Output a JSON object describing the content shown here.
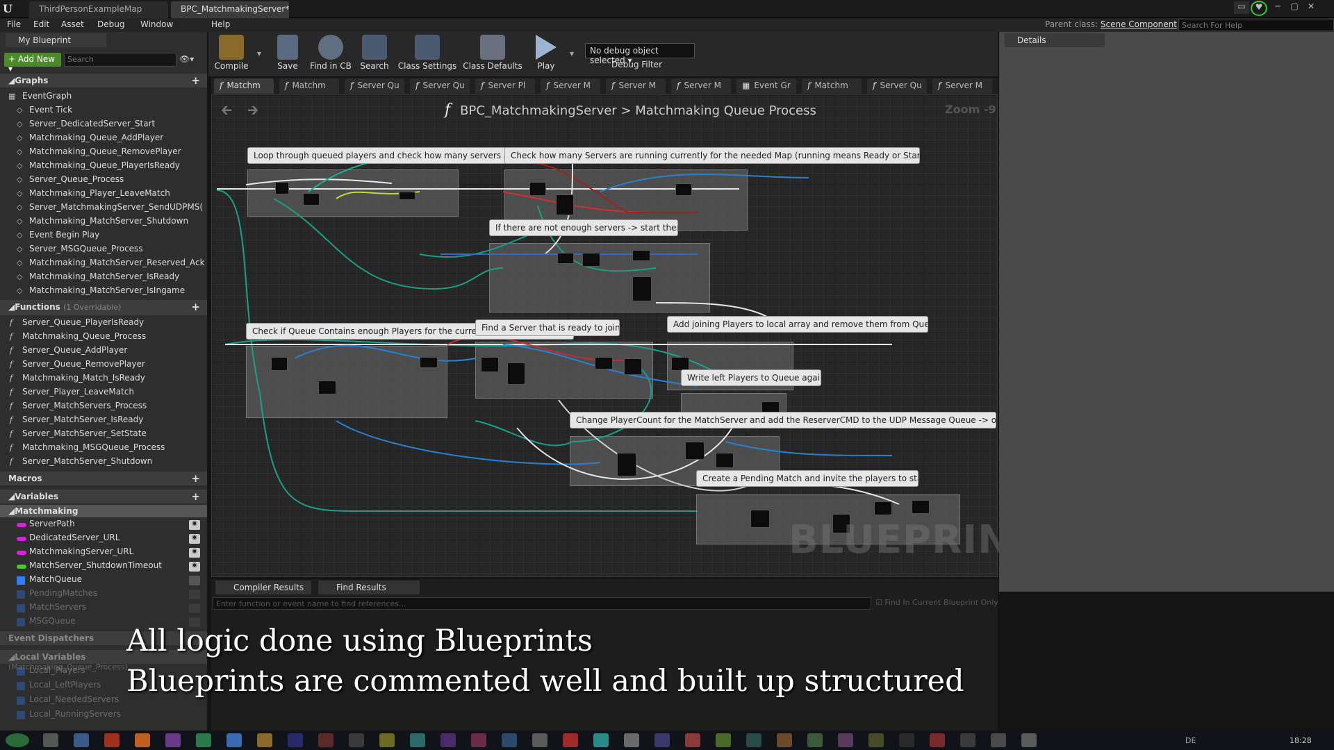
{
  "window": {
    "tabs": [
      {
        "label": "ThirdPersonExampleMap"
      },
      {
        "label": "BPC_MatchmakingServer*"
      }
    ]
  },
  "menu": [
    "File",
    "Edit",
    "Asset",
    "Debug",
    "Window",
    "Help"
  ],
  "header": {
    "parent_class_label": "Parent class:",
    "parent_class_value": "Scene Component",
    "help_search_placeholder": "Search For Help"
  },
  "left_panel": {
    "tab": "My Blueprint",
    "add_new": "Add New",
    "search_placeholder": "Search",
    "graphs_header": "Graphs",
    "event_graph": "EventGraph",
    "graph_items": [
      "Event Tick",
      "Server_DedicatedServer_Start",
      "Matchmaking_Queue_AddPlayer",
      "Matchmaking_Queue_RemovePlayer",
      "Matchmaking_Queue_PlayerIsReady",
      "Server_Queue_Process",
      "Matchmaking_Player_LeaveMatch",
      "Server_MatchmakingServer_SendUDPMS(",
      "Matchmaking_MatchServer_Shutdown",
      "Event Begin Play",
      "Server_MSGQueue_Process",
      "Matchmaking_MatchServer_Reserved_Ack",
      "Matchmaking_MatchServer_IsReady",
      "Matchmaking_MatchServer_IsIngame"
    ],
    "functions_header": "Functions",
    "functions_note": "(1 Overridable)",
    "functions": [
      "Server_Queue_PlayerIsReady",
      "Matchmaking_Queue_Process",
      "Server_Queue_AddPlayer",
      "Server_Queue_RemovePlayer",
      "Matchmaking_Match_IsReady",
      "Server_Player_LeaveMatch",
      "Server_MatchServers_Process",
      "Server_MatchServer_IsReady",
      "Server_MatchServer_SetState",
      "Matchmaking_MSGQueue_Process",
      "Server_MatchServer_Shutdown"
    ],
    "macros_header": "Macros",
    "variables_header": "Variables",
    "var_category": "Matchmaking",
    "variables": [
      {
        "name": "ServerPath",
        "color": "#e020e0"
      },
      {
        "name": "DedicatedServer_URL",
        "color": "#e020e0"
      },
      {
        "name": "MatchmakingServer_URL",
        "color": "#e020e0"
      },
      {
        "name": "MatchServer_ShutdownTimeout",
        "color": "#40d020"
      },
      {
        "name": "MatchQueue",
        "color": "#3080ff"
      },
      {
        "name": "PendingMatches",
        "color": "#3080ff"
      },
      {
        "name": "MatchServers",
        "color": "#3080ff"
      },
      {
        "name": "MSGQueue",
        "color": "#3080ff"
      }
    ],
    "dispatchers_header": "Event Dispatchers",
    "local_vars_header": "Local Variables",
    "local_vars_note": "(Matchmaking_Queue_Process)",
    "local_vars": [
      "Local_Players",
      "Local_LeftPlayers",
      "Local_NeededServers",
      "Local_RunningServers"
    ]
  },
  "toolbar": {
    "compile": "Compile",
    "save": "Save",
    "find_in_cb": "Find in CB",
    "search": "Search",
    "class_settings": "Class Settings",
    "class_defaults": "Class Defaults",
    "play": "Play",
    "debug_select": "No debug object selected",
    "debug_filter": "Debug Filter"
  },
  "function_tabs": [
    "Matchm",
    "Matchm",
    "Server Qu",
    "Server Qu",
    "Server Pl",
    "Server M",
    "Server M",
    "Server M",
    "Event Gr",
    "Matchm",
    "Server Qu",
    "Server M"
  ],
  "graph": {
    "breadcrumb_root": "BPC_MatchmakingServer",
    "breadcrumb_sep": ">",
    "breadcrumb_leaf": "Matchmaking Queue Process",
    "zoom": "Zoom -9",
    "watermark": "BLUEPRINT",
    "comments": [
      "Loop through queued players and check how many servers are needed for each Map",
      "Check how many Servers are running currently for the needed Map (running means Ready or Starting)",
      "If there are not enough servers -> start them",
      "Check if Queue Contains enough Players for the current Map (in ForEachLoop)",
      "Find a Server that is ready to join",
      "Add joining Players to local array and remove them from Queue",
      "Write left Players to Queue again",
      "Change PlayerCount for the MatchServer and add the ReserverCMD to the UDP Message Queue -> only res",
      "Create a Pending Match and invite the players to start"
    ]
  },
  "details": {
    "tab": "Details"
  },
  "bottom": {
    "tabs": [
      "Compiler Results",
      "Find Results"
    ],
    "search_placeholder": "Enter function or event name to find references...",
    "checkbox_label": "Find In Current Blueprint Only"
  },
  "captions": [
    "All logic done using Blueprints",
    "Blueprints are commented well and built up structured"
  ],
  "taskbar": {
    "language": "DE",
    "time": "18:28"
  }
}
